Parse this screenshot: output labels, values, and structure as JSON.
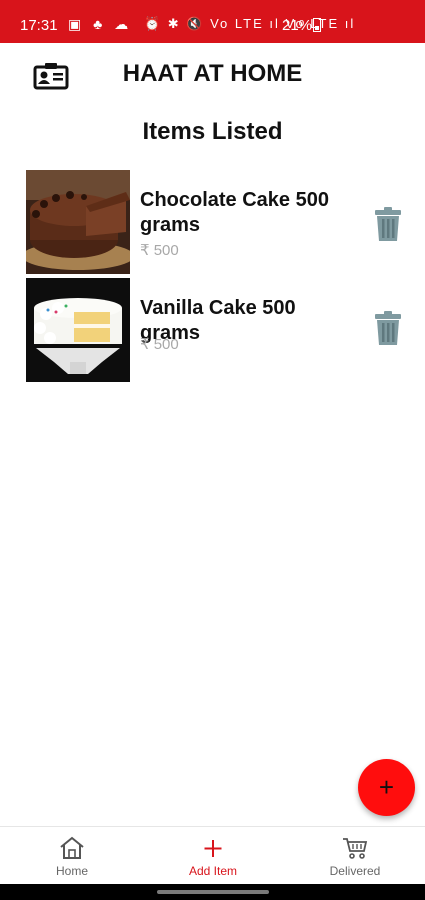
{
  "status_bar": {
    "time": "17:31",
    "left_icons": "▣ ♣ ☁",
    "right_icons": "⏰ ✱ 🔇 Vo LTE ıl Vo LTE ıl",
    "battery": "21%"
  },
  "header": {
    "title": "HAAT AT HOME",
    "profile_icon": "id-card-icon"
  },
  "section_title": "Items Listed",
  "items": [
    {
      "name": "Chocolate Cake 500 grams",
      "price": "₹ 500",
      "image": "chocolate-cake"
    },
    {
      "name": "Vanilla Cake 500 grams",
      "price": "₹ 500",
      "image": "vanilla-cake"
    }
  ],
  "fab": {
    "label": "+"
  },
  "bottom_nav": {
    "items": [
      {
        "label": "Home",
        "icon": "home-icon"
      },
      {
        "label": "Add Item",
        "icon": "plus-icon",
        "active": true
      },
      {
        "label": "Delivered",
        "icon": "cart-icon"
      }
    ]
  },
  "colors": {
    "brand": "#d8141b",
    "fab": "#ff0d0d",
    "delete_icon": "#7f9aa0"
  }
}
